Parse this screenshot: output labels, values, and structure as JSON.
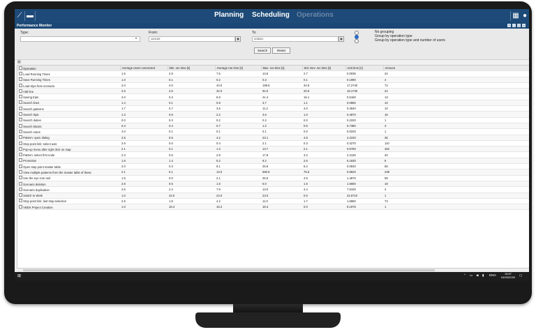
{
  "nav": {
    "planning": "Planning",
    "scheduling": "Scheduling",
    "operations": "Operations"
  },
  "panel": {
    "title": "Performance Monitor"
  },
  "filters": {
    "type_label": "Type:",
    "type_value": "",
    "from_label": "From:",
    "from_value": "12/1/20",
    "to_label": "To:",
    "to_value": "2/28/21",
    "grouping": [
      "No grouping",
      "Group by operation type",
      "Group by operation type and number of users"
    ],
    "selected_grouping": 1,
    "search_label": "Search",
    "reset_label": "Reset"
  },
  "table": {
    "columns": [
      "Operation",
      "Average users connected",
      "Min. run time [s]",
      "Average run time [s]",
      "Max. run time [s]",
      "Std. Dev. run time [s]",
      "Unit time [s]",
      "Amount"
    ],
    "rows": [
      [
        "Load Running Times",
        "1.5",
        "2.9",
        "7.5",
        "13.6",
        "2.7",
        "0.0035",
        "24"
      ],
      [
        "Save Running Times",
        "1.0",
        "0.1",
        "0.2",
        "0.3",
        "0.1",
        "0.1990",
        "4"
      ],
      [
        "Load trips from scenario",
        "2.0",
        "4.0",
        "43.0",
        "199.8",
        "34.8",
        "17.2740",
        "72"
      ],
      [
        "Add line",
        "2.5",
        "2.5",
        "32.0",
        "94.0",
        "20.9",
        "18.1730",
        "24"
      ],
      [
        "Saving trips",
        "2.0",
        "0.3",
        "6.9",
        "41.4",
        "15.1",
        "0.5160",
        "13"
      ],
      [
        "Search lines",
        "1.4",
        "0.1",
        "0.8",
        "3.7",
        "1.1",
        "0.0860",
        "10"
      ],
      [
        "Search patterns",
        "1.7",
        "0.7",
        "3.5",
        "11.2",
        "4.0",
        "0.3940",
        "10"
      ],
      [
        "Search trips",
        "1.3",
        "0.9",
        "2.2",
        "3.6",
        "1.0",
        "0.4870",
        "16"
      ],
      [
        "Search duties",
        "0.0",
        "0.3",
        "0.2",
        "0.2",
        "0.0",
        "0.2220",
        "1"
      ],
      [
        "Search blocks",
        "0.3",
        "0.4",
        "0.7",
        "1.2",
        "0.5",
        "0.7380",
        "3"
      ],
      [
        "Search notes",
        "4.0",
        "0.1",
        "0.1",
        "0.1",
        "0.0",
        "0.0220",
        "1"
      ],
      [
        "Pattern: open dialog",
        "2.5",
        "0.5",
        "4.2",
        "23.1",
        "4.8",
        "4.2220",
        "36"
      ],
      [
        "Stop point link: select axis",
        "2.6",
        "0.0",
        "0.4",
        "2.1",
        "0.3",
        "0.3270",
        "110"
      ],
      [
        "Pop-up menu after right click on map",
        "2.1",
        "0.1",
        "1.3",
        "13.7",
        "2.1",
        "0.8760",
        "462"
      ],
      [
        "Pattern: select first node",
        "2.3",
        "0.5",
        "2.8",
        "17.8",
        "3.2",
        "2.3130",
        "40"
      ],
      [
        "Promotion",
        "1.8",
        "1.4",
        "5.2",
        "9.2",
        "2.6",
        "5.1830",
        "6"
      ],
      [
        "Open stop point master table",
        "2.0",
        "0.3",
        "9.1",
        "25.8",
        "6.2",
        "0.0840",
        "58"
      ],
      [
        "View multiple patterns from the master table of these",
        "2.1",
        "0.1",
        "13.0",
        "590.6",
        "75.5",
        "0.8520",
        "239"
      ],
      [
        "Use the eye icon tool",
        "1.5",
        "0.0",
        "2.1",
        "25.6",
        "4.9",
        "1.4870",
        "58"
      ],
      [
        "Scenario deletion",
        "2.8",
        "0.5",
        "1.6",
        "6.0",
        "1.6",
        "1.5660",
        "18"
      ],
      [
        "Scenario duplication",
        "2.5",
        "2.4",
        "7.9",
        "13.0",
        "4.4",
        "7.9100",
        "4"
      ],
      [
        "Switch to Work",
        "1.0",
        "23.0",
        "23.0",
        "23.0",
        "0.0",
        "22.9710",
        "1"
      ],
      [
        "Stop point link: last stop selection",
        "2.5",
        "1.8",
        "4.2",
        "11.0",
        "1.7",
        "1.6860",
        "73"
      ],
      [
        "VBDS Project Creation",
        "1.0",
        "18.4",
        "18.4",
        "18.4",
        "0.0",
        "9.1975",
        "1"
      ]
    ]
  },
  "taskbar": {
    "lang": "ENG",
    "time": "16:57",
    "date": "04/03/2020"
  },
  "icons": [
    "tools-icon",
    "chat-icon",
    "grid-icon",
    "user-icon",
    "windows-icon"
  ]
}
